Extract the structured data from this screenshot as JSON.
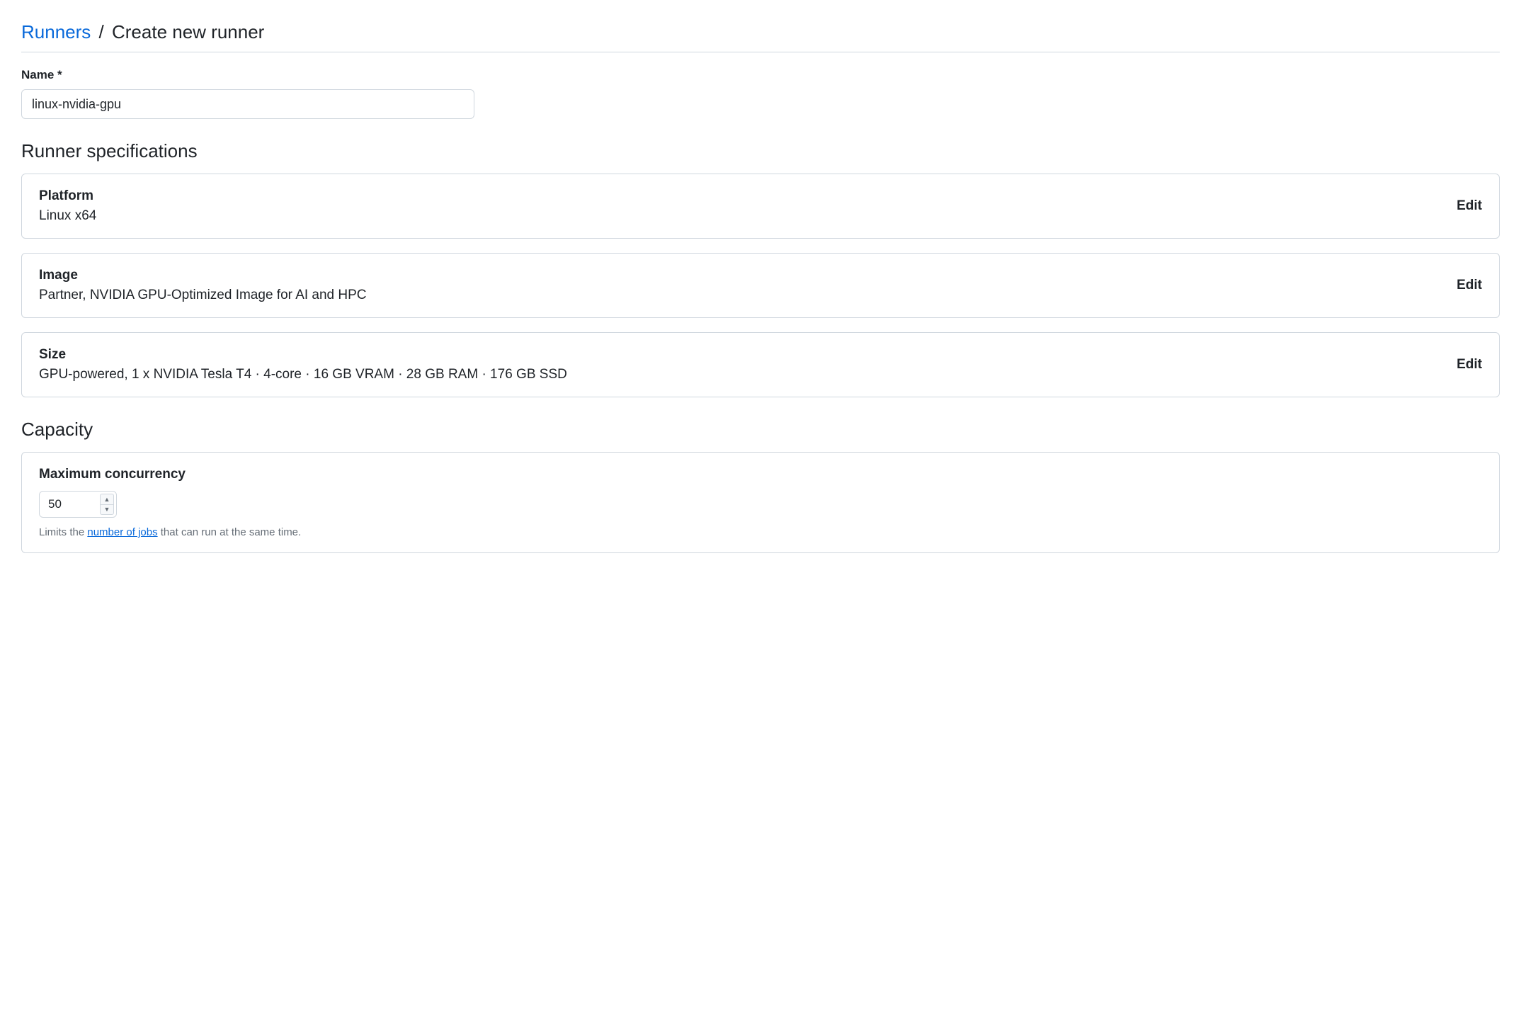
{
  "breadcrumb": {
    "parent": "Runners",
    "separator": "/",
    "current": "Create new runner"
  },
  "nameField": {
    "label": "Name *",
    "value": "linux-nvidia-gpu"
  },
  "specs": {
    "title": "Runner specifications",
    "editLabel": "Edit",
    "items": [
      {
        "label": "Platform",
        "value": "Linux x64"
      },
      {
        "label": "Image",
        "value": "Partner, NVIDIA GPU-Optimized Image for AI and HPC"
      },
      {
        "label": "Size",
        "value": "GPU-powered, 1 x NVIDIA Tesla T4 · 4-core · 16 GB VRAM · 28 GB RAM · 176 GB SSD"
      }
    ]
  },
  "capacity": {
    "title": "Capacity",
    "concurrency": {
      "label": "Maximum concurrency",
      "value": "50",
      "helperPrefix": "Limits the ",
      "helperLink": "number of jobs",
      "helperSuffix": " that can run at the same time."
    }
  }
}
